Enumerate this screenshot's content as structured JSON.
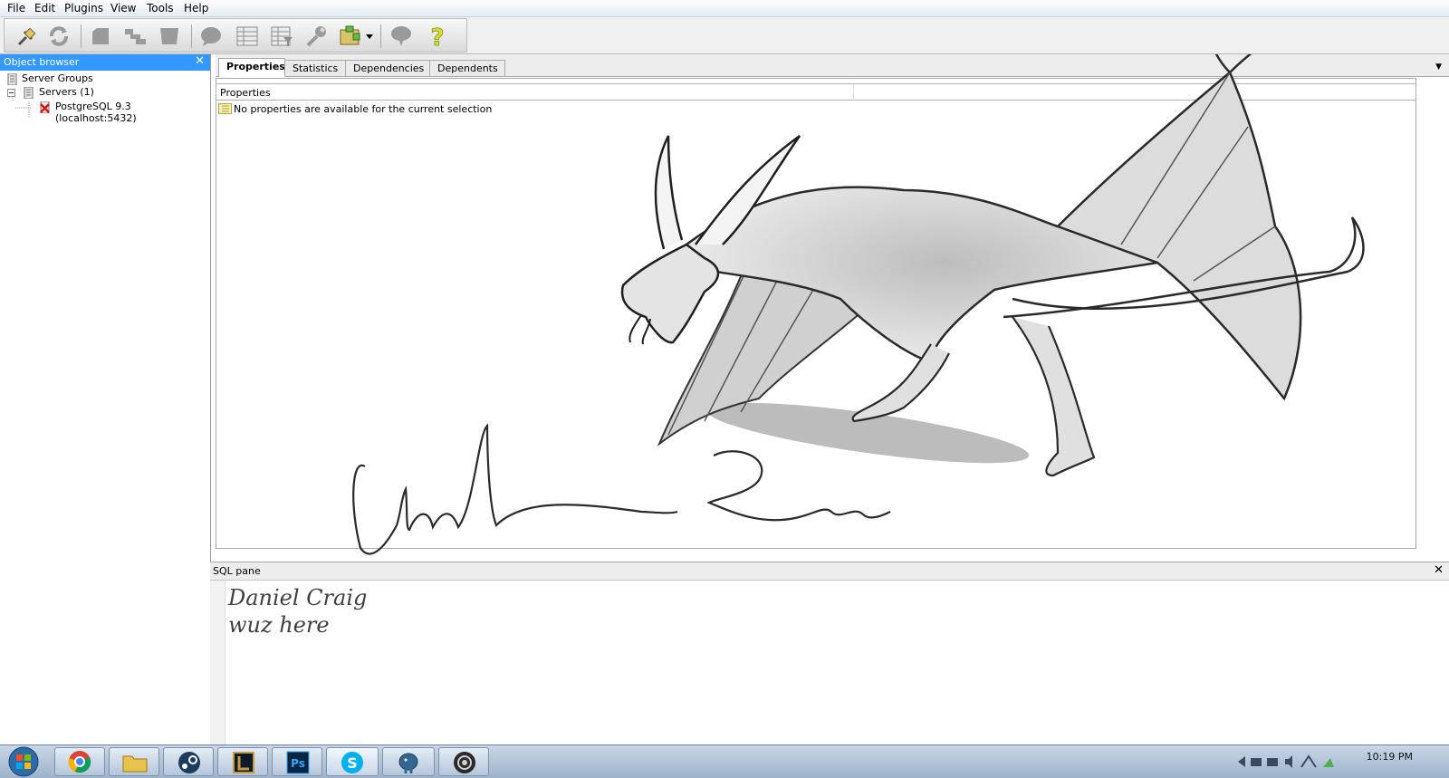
{
  "menu": [
    "File",
    "Edit",
    "Plugins",
    "View",
    "Tools",
    "Help"
  ],
  "toolbar_icons": [
    "connect-plug-icon",
    "refresh-icon",
    "properties-icon",
    "create-object-icon",
    "drop-object-icon",
    "sql-query-icon",
    "view-data-icon",
    "filtered-data-icon",
    "maintenance-wrench-icon",
    "plugins-icon",
    "hint-icon",
    "help-icon"
  ],
  "object_browser": {
    "title": "Object browser",
    "close": "✕",
    "tree": [
      {
        "label": "Server Groups"
      },
      {
        "label": "Servers (1)"
      },
      {
        "label": "PostgreSQL 9.3 (localhost:5432)"
      }
    ]
  },
  "properties": {
    "tabs": [
      "Properties",
      "Statistics",
      "Dependencies",
      "Dependents"
    ],
    "active_tab": "Properties",
    "column_header": "Properties",
    "message": "No properties are available for the current selection"
  },
  "sql_pane": {
    "title": "SQL pane",
    "close": "✕",
    "handwriting": [
      "Daniel Craig",
      "wuz here"
    ]
  },
  "taskbar": {
    "apps": [
      "start-orb",
      "chrome",
      "file-explorer",
      "steam",
      "league-of-legends",
      "photoshop",
      "skype",
      "pgadmin",
      "obs"
    ],
    "clock": "10:19 PM"
  }
}
